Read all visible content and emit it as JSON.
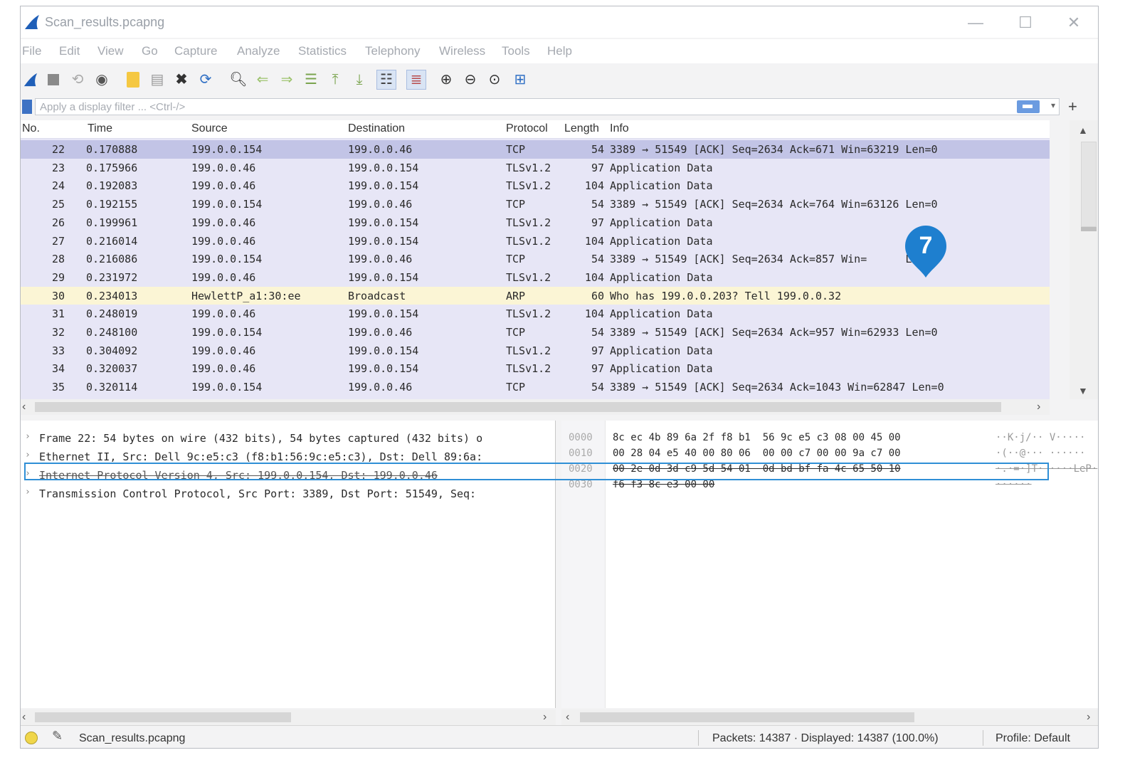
{
  "window": {
    "title": "Scan_results.pcapng",
    "accent": "#2f8fd6"
  },
  "menu": [
    "File",
    "Edit",
    "View",
    "Go",
    "Capture",
    "Analyze",
    "Statistics",
    "Telephony",
    "Wireless",
    "Tools",
    "Help"
  ],
  "toolbar_icons": [
    "shark-fin-start-icon",
    "stop-icon",
    "restart-icon",
    "options-gear-icon",
    "open-folder-icon",
    "save-file-icon",
    "close-file-icon",
    "reload-icon",
    "find-icon",
    "back-icon",
    "forward-icon",
    "go-to-packet-icon",
    "first-packet-icon",
    "last-packet-icon",
    "autoscroll-icon",
    "colorize-icon",
    "zoom-in-icon",
    "zoom-out-icon",
    "zoom-normal-icon",
    "resize-columns-icon"
  ],
  "filter": {
    "placeholder": "Apply a display filter ... <Ctrl-/>"
  },
  "columns": [
    "No.",
    "Time",
    "Source",
    "Destination",
    "Protocol",
    "Length",
    "Info"
  ],
  "packets": [
    {
      "no": "22",
      "time": "0.170888",
      "src": "199.0.0.154",
      "dst": "199.0.0.46",
      "proto": "TCP",
      "len": "54",
      "info": "3389 → 51549 [ACK] Seq=2634 Ack=671 Win=63219 Len=0",
      "style": "sel"
    },
    {
      "no": "23",
      "time": "0.175966",
      "src": "199.0.0.46",
      "dst": "199.0.0.154",
      "proto": "TLSv1.2",
      "len": "97",
      "info": "Application Data",
      "style": ""
    },
    {
      "no": "24",
      "time": "0.192083",
      "src": "199.0.0.46",
      "dst": "199.0.0.154",
      "proto": "TLSv1.2",
      "len": "104",
      "info": "Application Data",
      "style": ""
    },
    {
      "no": "25",
      "time": "0.192155",
      "src": "199.0.0.154",
      "dst": "199.0.0.46",
      "proto": "TCP",
      "len": "54",
      "info": "3389 → 51549 [ACK] Seq=2634 Ack=764 Win=63126 Len=0",
      "style": ""
    },
    {
      "no": "26",
      "time": "0.199961",
      "src": "199.0.0.46",
      "dst": "199.0.0.154",
      "proto": "TLSv1.2",
      "len": "97",
      "info": "Application Data",
      "style": ""
    },
    {
      "no": "27",
      "time": "0.216014",
      "src": "199.0.0.46",
      "dst": "199.0.0.154",
      "proto": "TLSv1.2",
      "len": "104",
      "info": "Application Data",
      "style": ""
    },
    {
      "no": "28",
      "time": "0.216086",
      "src": "199.0.0.154",
      "dst": "199.0.0.46",
      "proto": "TCP",
      "len": "54",
      "info": "3389 → 51549 [ACK] Seq=2634 Ack=857 Win=      Len=0",
      "style": ""
    },
    {
      "no": "29",
      "time": "0.231972",
      "src": "199.0.0.46",
      "dst": "199.0.0.154",
      "proto": "TLSv1.2",
      "len": "104",
      "info": "Application Data",
      "style": ""
    },
    {
      "no": "30",
      "time": "0.234013",
      "src": "HewlettP_a1:30:ee",
      "dst": "Broadcast",
      "proto": "ARP",
      "len": "60",
      "info": "Who has 199.0.0.203? Tell 199.0.0.32",
      "style": "arp"
    },
    {
      "no": "31",
      "time": "0.248019",
      "src": "199.0.0.46",
      "dst": "199.0.0.154",
      "proto": "TLSv1.2",
      "len": "104",
      "info": "Application Data",
      "style": ""
    },
    {
      "no": "32",
      "time": "0.248100",
      "src": "199.0.0.154",
      "dst": "199.0.0.46",
      "proto": "TCP",
      "len": "54",
      "info": "3389 → 51549 [ACK] Seq=2634 Ack=957 Win=62933 Len=0",
      "style": ""
    },
    {
      "no": "33",
      "time": "0.304092",
      "src": "199.0.0.46",
      "dst": "199.0.0.154",
      "proto": "TLSv1.2",
      "len": "97",
      "info": "Application Data",
      "style": ""
    },
    {
      "no": "34",
      "time": "0.320037",
      "src": "199.0.0.46",
      "dst": "199.0.0.154",
      "proto": "TLSv1.2",
      "len": "97",
      "info": "Application Data",
      "style": ""
    },
    {
      "no": "35",
      "time": "0.320114",
      "src": "199.0.0.154",
      "dst": "199.0.0.46",
      "proto": "TCP",
      "len": "54",
      "info": "3389 → 51549 [ACK] Seq=2634 Ack=1043 Win=62847 Len=0",
      "style": ""
    }
  ],
  "details": [
    "Frame 22: 54 bytes on wire (432 bits), 54 bytes captured (432 bits) o",
    "Ethernet II, Src: Dell_9c:e5:c3 (f8:b1:56:9c:e5:c3), Dst: Dell_89:6a:",
    "Internet Protocol Version 4, Src: 199.0.0.154, Dst: 199.0.0.46",
    "Transmission Control Protocol, Src Port: 3389, Dst Port: 51549, Seq:"
  ],
  "bytes": [
    {
      "off": "0000",
      "hex": "8c ec 4b 89 6a 2f f8 b1  56 9c e5 c3 08 00 45 00",
      "ascii": "··K·j/·· V·····"
    },
    {
      "off": "0010",
      "hex": "00 28 04 e5 40 00 80 06  00 00 c7 00 00 9a c7 00",
      "ascii": "·(··@··· ······"
    },
    {
      "off": "0020",
      "hex": "00 2e 0d 3d c9 5d 54 01  0d bd bf fa 4c 65 50 10",
      "ascii": "·.·=·]T· ····LeP·"
    },
    {
      "off": "0030",
      "hex": "f6 f3 8c e3 00 00",
      "ascii": "······"
    }
  ],
  "callout": {
    "number": "7"
  },
  "status": {
    "file": "Scan_results.pcapng",
    "packets": "Packets: 14387 · Displayed: 14387 (100.0%)",
    "profile": "Profile: Default"
  }
}
